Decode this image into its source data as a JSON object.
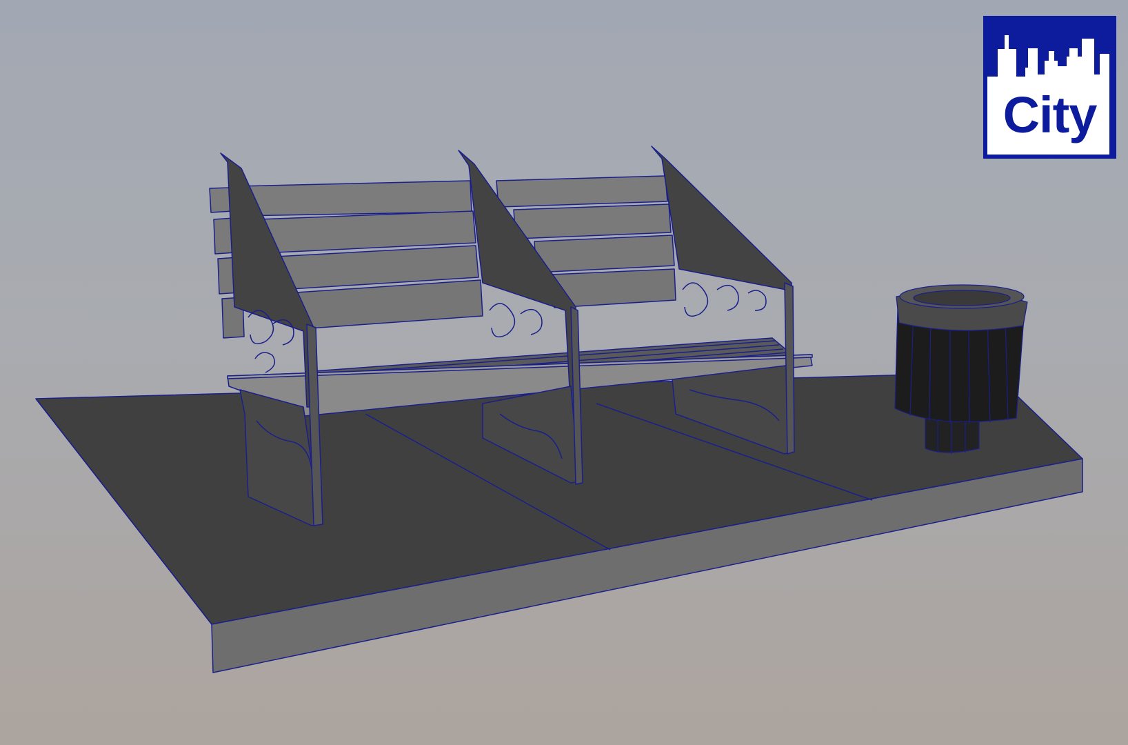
{
  "logo": {
    "text": "City"
  },
  "colors": {
    "background_top": "#a2a8b3",
    "background_bottom": "#aca49e",
    "wireframe": "#1a1f8a",
    "platform_top": "#404040",
    "platform_side": "#6e6e6e",
    "bench_slat": "#7c7c7c",
    "bench_side": "#434343",
    "bin_body": "#1c1c1c",
    "logo_blue": "#0c1c9c"
  },
  "scene": {
    "objects": [
      "platform",
      "bench",
      "trash-bin"
    ]
  }
}
